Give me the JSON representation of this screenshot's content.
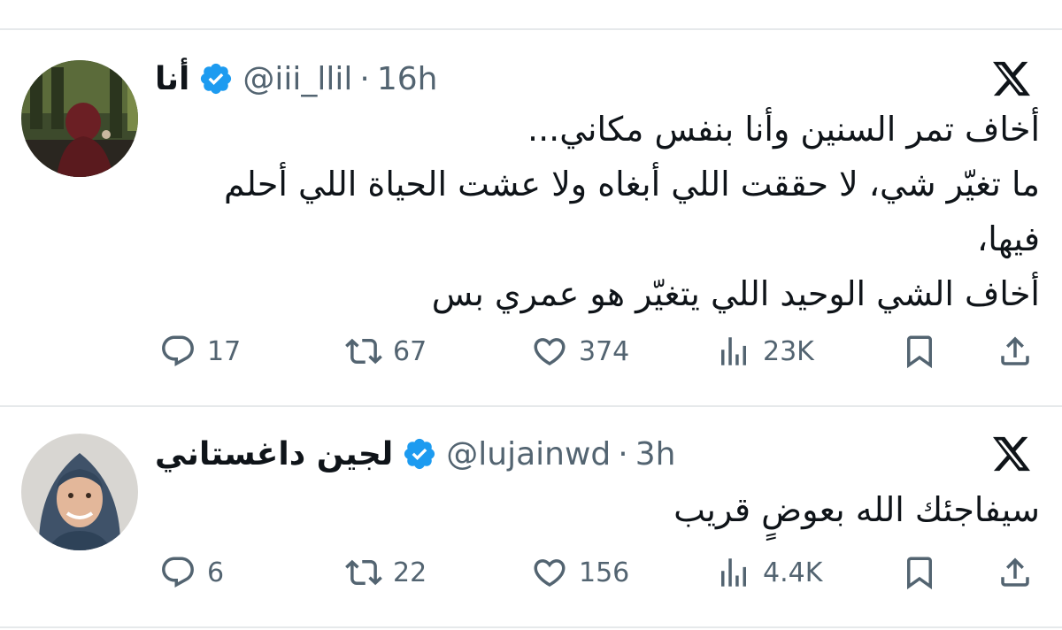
{
  "tweets": [
    {
      "display_name": "أنا",
      "handle": "@iii_llil",
      "separator": "·",
      "time": "16h",
      "verified": true,
      "text_lines": [
        "أخاف تمر السنين وأنا بنفس مكاني...",
        "ما تغيّر شي، لا حققت اللي أبغاه ولا عشت الحياة اللي أحلم",
        "فيها،",
        "أخاف الشي الوحيد اللي يتغيّر هو عمري بس"
      ],
      "stats": {
        "replies": "17",
        "reposts": "67",
        "likes": "374",
        "views": "23K"
      }
    },
    {
      "display_name": "لجين داغستاني",
      "handle": "@lujainwd",
      "separator": "·",
      "time": "3h",
      "verified": true,
      "text_lines": [
        "سيفاجئك الله بعوضٍ قريب"
      ],
      "stats": {
        "replies": "6",
        "reposts": "22",
        "likes": "156",
        "views": "4.4K"
      }
    }
  ],
  "colors": {
    "text": "#0f1419",
    "secondary": "#536471",
    "verified_badge": "#1d9bf0",
    "divider": "#e6e9eb"
  },
  "icons": [
    "reply-icon",
    "repost-icon",
    "like-icon",
    "views-icon",
    "bookmark-icon",
    "share-icon",
    "x-logo-icon",
    "verified-badge-icon"
  ]
}
